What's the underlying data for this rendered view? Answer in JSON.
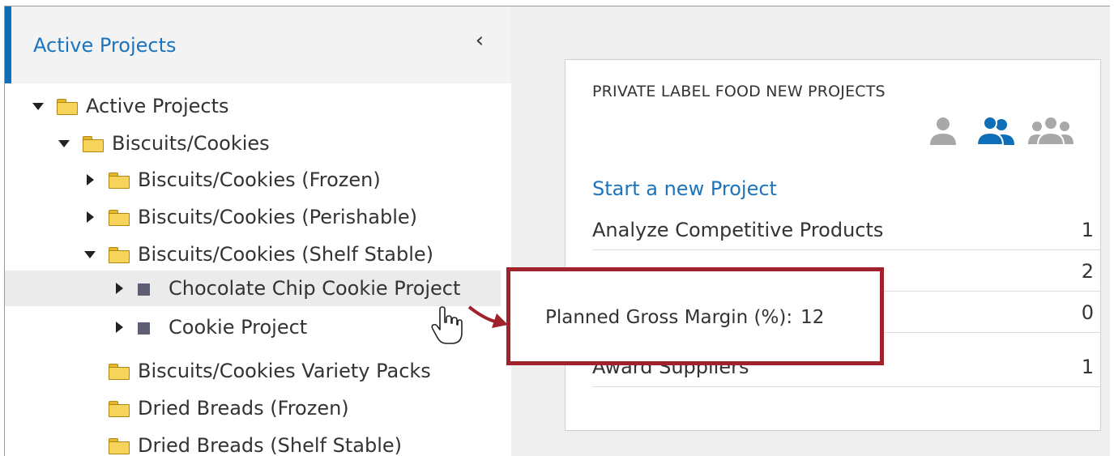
{
  "sidebar": {
    "title": "Active Projects",
    "collapse_icon": "chevron-left-icon",
    "tree": [
      {
        "label": "Active Projects",
        "type": "folder",
        "state": "expanded",
        "level": 0
      },
      {
        "label": "Biscuits/Cookies",
        "type": "folder",
        "state": "expanded",
        "level": 1
      },
      {
        "label": "Biscuits/Cookies (Frozen)",
        "type": "folder",
        "state": "collapsed",
        "level": 2
      },
      {
        "label": "Biscuits/Cookies (Perishable)",
        "type": "folder",
        "state": "collapsed",
        "level": 2
      },
      {
        "label": "Biscuits/Cookies (Shelf Stable)",
        "type": "folder",
        "state": "expanded",
        "level": 2
      },
      {
        "label": "Chocolate Chip Cookie Project",
        "type": "project",
        "state": "collapsed",
        "level": 3,
        "selected": true
      },
      {
        "label": "Cookie Project",
        "type": "project",
        "state": "collapsed",
        "level": 3
      },
      {
        "label": "Biscuits/Cookies Variety Packs",
        "type": "folder",
        "state": "leaf",
        "level": 2
      },
      {
        "label": "Dried Breads (Frozen)",
        "type": "folder",
        "state": "leaf",
        "level": 2
      },
      {
        "label": "Dried Breads (Shelf Stable)",
        "type": "folder",
        "state": "leaf",
        "level": 2
      }
    ]
  },
  "card": {
    "title": "PRIVATE LABEL FOOD NEW PROJECTS",
    "view_icons": [
      "user-icon",
      "users-icon",
      "group-icon"
    ],
    "active_view": "users-icon",
    "link": "Start a new Project",
    "tasks": [
      {
        "label": "Analyze Competitive Products",
        "count": "1"
      },
      {
        "label": "",
        "count": "2"
      },
      {
        "label": "",
        "count": "0"
      },
      {
        "label": "Award Suppliers",
        "count": "1"
      }
    ]
  },
  "tooltip": {
    "label": "Planned Gross Margin (%):",
    "value": "12"
  },
  "colors": {
    "accent": "#1b74bd",
    "callout": "#a0222b",
    "folder": "#f6d35b"
  }
}
